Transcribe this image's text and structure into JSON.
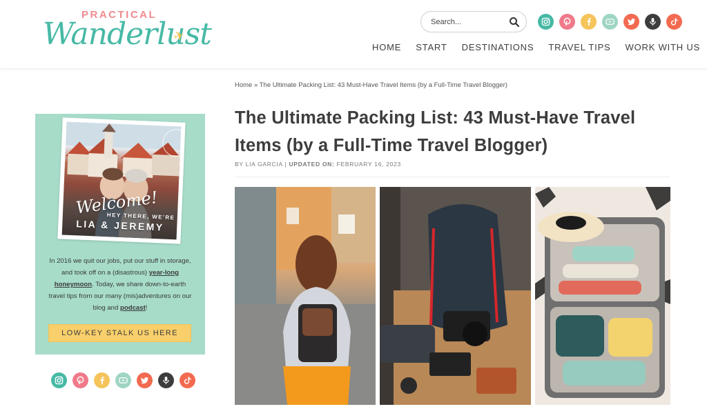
{
  "header": {
    "logo_small": "PRACTICAL",
    "logo_script": "Wanderlust",
    "search_placeholder": "Search...",
    "social": [
      {
        "icon": "instagram-icon",
        "color": "#47b9a5"
      },
      {
        "icon": "pinterest-icon",
        "color": "#f07a8a"
      },
      {
        "icon": "facebook-icon",
        "color": "#f5c45a"
      },
      {
        "icon": "youtube-icon",
        "color": "#9fd5c4"
      },
      {
        "icon": "twitter-icon",
        "color": "#f26a50"
      },
      {
        "icon": "podcast-icon",
        "color": "#3d3d3d"
      },
      {
        "icon": "tiktok-icon",
        "color": "#f26a50"
      }
    ],
    "nav": [
      "HOME",
      "START",
      "DESTINATIONS",
      "TRAVEL TIPS",
      "WORK WITH US"
    ]
  },
  "sidebar": {
    "welcome": "Welcome!",
    "hey": "HEY THERE, WE'RE",
    "names": "LIA & JEREMY",
    "bio_1": "In 2016 we quit our jobs, put our stuff in storage, and took off on a (disastrous) ",
    "bio_link_1": "year-long honeymoon",
    "bio_2": ". Today, we share down-to-earth travel tips from our many (mis)adventures on our blog and ",
    "bio_link_2": "podcast",
    "bio_3": "!",
    "button": "LOW-KEY STALK US HERE",
    "bg_color": "#a7dcc9",
    "button_color": "#f8cf6a"
  },
  "article": {
    "breadcrumb_home": "Home",
    "breadcrumb_sep": " » ",
    "breadcrumb_current": "The Ultimate Packing List: 43 Must-Have Travel Items (by a Full-Time Travel Blogger)",
    "title": "The Ultimate Packing List: 43 Must-Have Travel Items (by a Full-Time Travel Blogger)",
    "byline_prefix": "BY LIA GARCIA",
    "byline_sep": " | ",
    "byline_updated": "UPDATED ON:",
    "byline_date": " FEBRUARY 16, 2023"
  }
}
